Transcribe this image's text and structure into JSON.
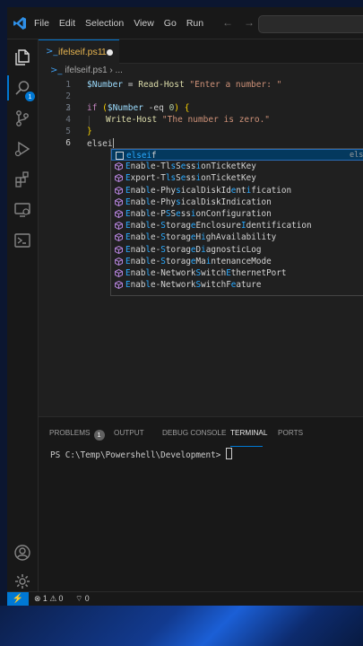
{
  "app": {
    "menu": [
      "File",
      "Edit",
      "Selection",
      "View",
      "Go",
      "Run"
    ],
    "nav_back_icon": "arrow-left-icon",
    "nav_forward_icon": "arrow-right-icon"
  },
  "activity_bar": {
    "explorer_badge": "1",
    "items": [
      "explorer",
      "search",
      "source-control",
      "run-debug",
      "extensions",
      "remote-explorer",
      "powershell"
    ],
    "bottom": [
      "accounts",
      "manage"
    ]
  },
  "tab": {
    "file_name": "ifelseif.ps1",
    "problems": "1"
  },
  "breadcrumb": {
    "file": "ifelseif.ps1",
    "separator": "›",
    "more": "..."
  },
  "editor": {
    "line_numbers": [
      "1",
      "2",
      "3",
      "4",
      "5",
      "6"
    ],
    "lines": {
      "l1_var": "$Number",
      "l1_op": " = ",
      "l1_cmd": "Read-Host",
      "l1_str": " \"Enter a number: \"",
      "l3_kw": "if",
      "l3_open": " (",
      "l3_var": "$Number",
      "l3_op": " -eq ",
      "l3_num": "0",
      "l3_close": ")",
      "l3_brace": " {",
      "l4_cmd": "Write-Host",
      "l4_str": " \"The number is zero.\"",
      "l5_brace": "}",
      "l6_text": "elsei"
    }
  },
  "suggestions": {
    "detail": "elseif",
    "items": [
      {
        "pre": "",
        "match": "elseif",
        "post": ""
      },
      {
        "pre": "",
        "match": "E",
        "post": "nable-T",
        "m2": "l",
        "p2": "s",
        "m3": "S",
        "p3": "ess",
        "m4": "i",
        "p4": "onTicketKey",
        "full": "Enable-TlsSessionTicketKey"
      },
      {
        "full": "Export-TlsSessionTicketKey"
      },
      {
        "full": "Enable-PhysicalDiskIdentification"
      },
      {
        "full": "Enable-PhysicalDiskIndication"
      },
      {
        "full": "Enable-PSSessionConfiguration"
      },
      {
        "full": "Enable-StorageEnclosureIdentification"
      },
      {
        "full": "Enable-StorageHighAvailability"
      },
      {
        "full": "Enable-StorageDiagnosticLog"
      },
      {
        "full": "Enable-StorageMaintenanceMode"
      },
      {
        "full": "Enable-NetworkSwitchEthernetPort"
      },
      {
        "full": "Enable-NetworkSwitchFeature"
      }
    ]
  },
  "panel": {
    "tabs": [
      "PROBLEMS",
      "OUTPUT",
      "DEBUG CONSOLE",
      "TERMINAL",
      "PORTS"
    ],
    "problems_count": "1",
    "active_tab": "TERMINAL",
    "prompt": "PS C:\\Temp\\Powershell\\Development> "
  },
  "status": {
    "errors": "1",
    "warnings": "0",
    "ports": "0"
  },
  "colors": {
    "accent": "#0078d4",
    "editor_bg": "#1f1f1f",
    "suggest_match": "#2aaaff"
  }
}
